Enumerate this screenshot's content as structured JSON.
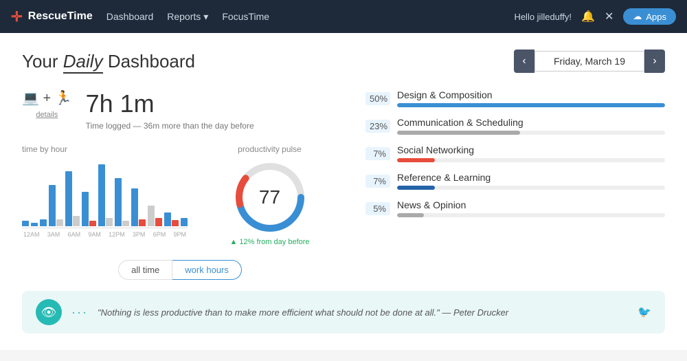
{
  "nav": {
    "logo_text": "RescueTime",
    "links": [
      "Dashboard",
      "Reports",
      "FocusTime"
    ],
    "user_greeting": "Hello jilleduffy!",
    "apps_label": "Apps",
    "reports_has_dropdown": true
  },
  "header": {
    "title_prefix": "Your",
    "title_italic": "Daily",
    "title_suffix": "Dashboard",
    "date": "Friday, March 19"
  },
  "stats": {
    "time": "7h 1m",
    "subtitle": "Time logged — 36m more than the day before",
    "details_label": "details"
  },
  "chart": {
    "label": "time by hour",
    "time_labels": [
      "12AM",
      "3AM",
      "6AM",
      "9AM",
      "12PM",
      "3PM",
      "6PM",
      "9PM"
    ]
  },
  "pulse": {
    "label": "productivity pulse",
    "value": "77",
    "change": "▲ 12% from day before"
  },
  "categories": [
    {
      "pct": "50%",
      "name": "Design & Composition",
      "fill": 50,
      "color": "blue"
    },
    {
      "pct": "23%",
      "name": "Communication & Scheduling",
      "fill": 23,
      "color": "gray"
    },
    {
      "pct": "7%",
      "name": "Social Networking",
      "fill": 7,
      "color": "red"
    },
    {
      "pct": "7%",
      "name": "Reference & Learning",
      "fill": 7,
      "color": "darkblue"
    },
    {
      "pct": "5%",
      "name": "News & Opinion",
      "fill": 5,
      "color": "gray"
    }
  ],
  "toggles": {
    "option1": "all time",
    "option2": "work hours"
  },
  "quote": {
    "text": "\"Nothing is less productive than to make more efficient what should not be done at all.\" — Peter Drucker"
  }
}
